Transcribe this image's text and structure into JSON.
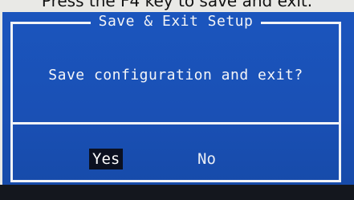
{
  "caption": "Press the F4 key to save and exit.",
  "dialog": {
    "title": "Save & Exit Setup",
    "prompt": "Save configuration and exit?",
    "buttons": {
      "yes": "Yes",
      "no": "No"
    },
    "selected": "Yes"
  },
  "colors": {
    "background": "#1b55bd",
    "border": "#f1f3f7",
    "text": "#f5f6f8",
    "selected_bg": "#0b1020"
  }
}
